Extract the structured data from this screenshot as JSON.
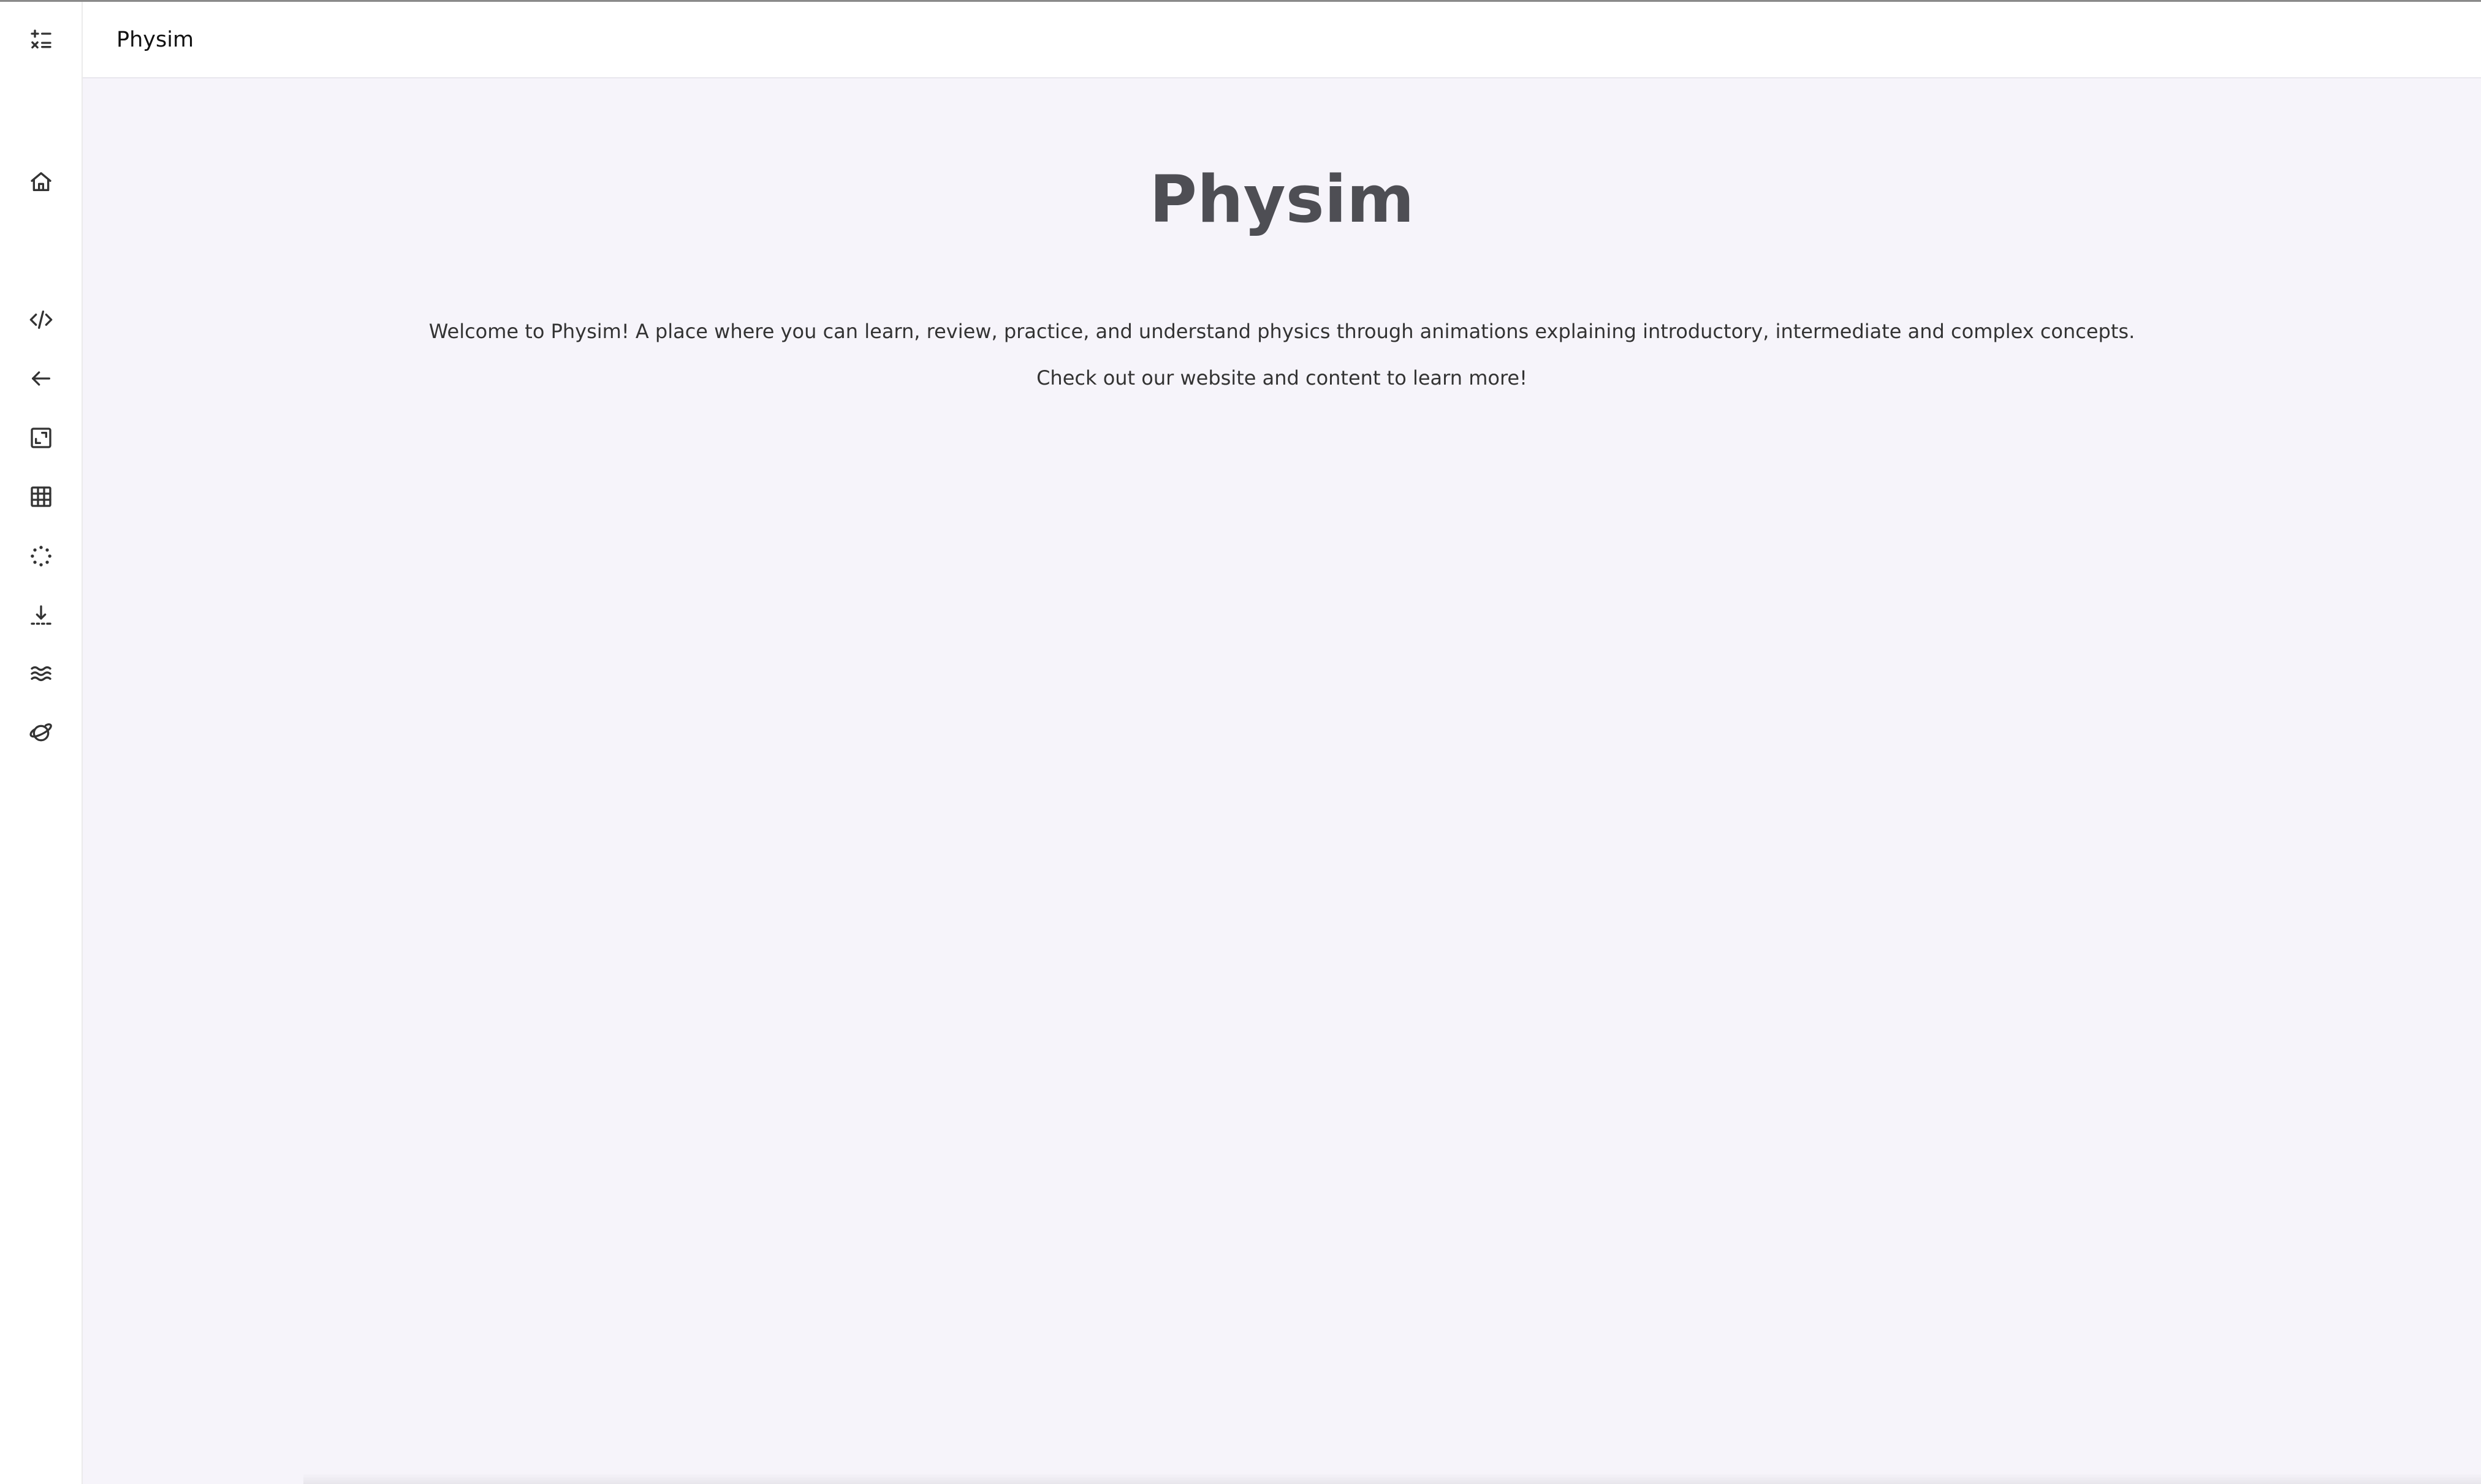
{
  "header": {
    "title": "Physim"
  },
  "sidebar": {
    "items": [
      {
        "icon": "calculator-icon",
        "label": "Calculator"
      },
      {
        "icon": "home-icon",
        "label": "Home"
      },
      {
        "icon": "code-icon",
        "label": "Code"
      },
      {
        "icon": "arrow-left-icon",
        "label": "Back"
      },
      {
        "icon": "expand-icon",
        "label": "Expand"
      },
      {
        "icon": "grid-icon",
        "label": "Grid"
      },
      {
        "icon": "dotted-circle-icon",
        "label": "Rotation"
      },
      {
        "icon": "arrow-down-dashed-icon",
        "label": "Gravity"
      },
      {
        "icon": "waves-icon",
        "label": "Waves"
      },
      {
        "icon": "planet-icon",
        "label": "Planet"
      }
    ]
  },
  "main": {
    "hero_title": "Physim",
    "intro_line_1": "Welcome to Physim! A place where you can learn, review, practice, and understand physics through animations explaining introductory, intermediate and complex concepts.",
    "intro_line_2": "Check out our website and content to learn more!"
  },
  "colors": {
    "background": "#f6f4fa",
    "surface": "#ffffff",
    "hero_text": "#4e4e54",
    "body_text": "#333333"
  }
}
